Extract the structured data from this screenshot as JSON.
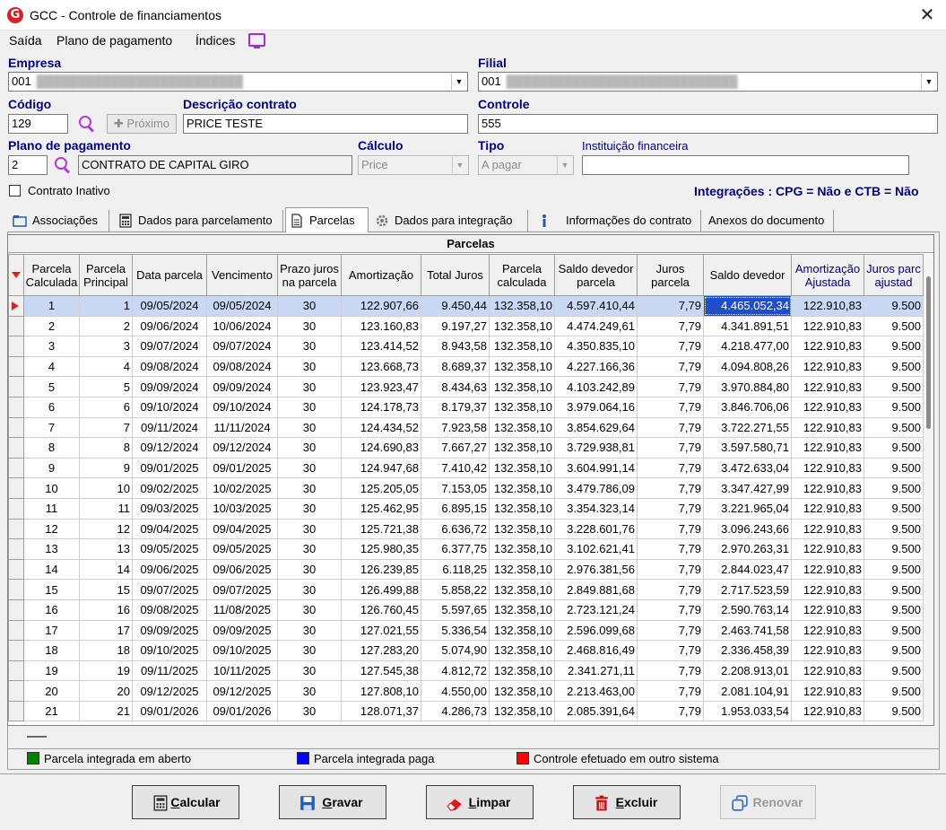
{
  "window": {
    "title": "GCC - Controle de financiamentos",
    "logo_letter": "G",
    "close_glyph": "✕"
  },
  "menu": [
    "Saída",
    "Plano de pagamento",
    "Índices"
  ],
  "form": {
    "empresa_label": "Empresa",
    "empresa_code": "001",
    "filial_label": "Filial",
    "filial_code": "001",
    "codigo_label": "Código",
    "codigo_value": "129",
    "proximo_label": "Próximo",
    "descricao_label": "Descrição contrato",
    "descricao_value": "PRICE TESTE",
    "controle_label": "Controle",
    "controle_value": "555",
    "plano_label": "Plano de pagamento",
    "plano_value": "2",
    "plano_desc": "CONTRATO DE CAPITAL GIRO",
    "calculo_label": "Cálculo",
    "calculo_value": "Price",
    "tipo_label": "Tipo",
    "tipo_value": "A pagar",
    "instituicao_label": "Instituição financeira",
    "instituicao_value": "",
    "inativo_label": "Contrato Inativo",
    "integracoes": "Integrações : CPG = Não e CTB = Não"
  },
  "tabs": [
    "Associações",
    "Dados para parcelamento",
    "Parcelas",
    "Dados para integração",
    "Informações do contrato",
    "Anexos do documento"
  ],
  "grid": {
    "caption": "Parcelas",
    "headers": [
      "Parcela Calculada",
      "Parcela Principal",
      "Data parcela",
      "Vencimento",
      "Prazo juros na parcela",
      "Amortização",
      "Total Juros",
      "Parcela calculada",
      "Saldo devedor parcela",
      "Juros parcela",
      "Saldo devedor",
      "Amortização Ajustada",
      "Juros parc ajustad"
    ],
    "rows": [
      [
        "1",
        "1",
        "09/05/2024",
        "09/05/2024",
        "30",
        "122.907,66",
        "9.450,44",
        "132.358,10",
        "4.597.410,44",
        "7,79",
        "4.465.052,34",
        "122.910,83",
        "9.500"
      ],
      [
        "2",
        "2",
        "09/06/2024",
        "10/06/2024",
        "30",
        "123.160,83",
        "9.197,27",
        "132.358,10",
        "4.474.249,61",
        "7,79",
        "4.341.891,51",
        "122.910,83",
        "9.500"
      ],
      [
        "3",
        "3",
        "09/07/2024",
        "09/07/2024",
        "30",
        "123.414,52",
        "8.943,58",
        "132.358,10",
        "4.350.835,10",
        "7,79",
        "4.218.477,00",
        "122.910,83",
        "9.500"
      ],
      [
        "4",
        "4",
        "09/08/2024",
        "09/08/2024",
        "30",
        "123.668,73",
        "8.689,37",
        "132.358,10",
        "4.227.166,36",
        "7,79",
        "4.094.808,26",
        "122.910,83",
        "9.500"
      ],
      [
        "5",
        "5",
        "09/09/2024",
        "09/09/2024",
        "30",
        "123.923,47",
        "8.434,63",
        "132.358,10",
        "4.103.242,89",
        "7,79",
        "3.970.884,80",
        "122.910,83",
        "9.500"
      ],
      [
        "6",
        "6",
        "09/10/2024",
        "09/10/2024",
        "30",
        "124.178,73",
        "8.179,37",
        "132.358,10",
        "3.979.064,16",
        "7,79",
        "3.846.706,06",
        "122.910,83",
        "9.500"
      ],
      [
        "7",
        "7",
        "09/11/2024",
        "11/11/2024",
        "30",
        "124.434,52",
        "7.923,58",
        "132.358,10",
        "3.854.629,64",
        "7,79",
        "3.722.271,55",
        "122.910,83",
        "9.500"
      ],
      [
        "8",
        "8",
        "09/12/2024",
        "09/12/2024",
        "30",
        "124.690,83",
        "7.667,27",
        "132.358,10",
        "3.729.938,81",
        "7,79",
        "3.597.580,71",
        "122.910,83",
        "9.500"
      ],
      [
        "9",
        "9",
        "09/01/2025",
        "09/01/2025",
        "30",
        "124.947,68",
        "7.410,42",
        "132.358,10",
        "3.604.991,14",
        "7,79",
        "3.472.633,04",
        "122.910,83",
        "9.500"
      ],
      [
        "10",
        "10",
        "09/02/2025",
        "10/02/2025",
        "30",
        "125.205,05",
        "7.153,05",
        "132.358,10",
        "3.479.786,09",
        "7,79",
        "3.347.427,99",
        "122.910,83",
        "9.500"
      ],
      [
        "11",
        "11",
        "09/03/2025",
        "10/03/2025",
        "30",
        "125.462,95",
        "6.895,15",
        "132.358,10",
        "3.354.323,14",
        "7,79",
        "3.221.965,04",
        "122.910,83",
        "9.500"
      ],
      [
        "12",
        "12",
        "09/04/2025",
        "09/04/2025",
        "30",
        "125.721,38",
        "6.636,72",
        "132.358,10",
        "3.228.601,76",
        "7,79",
        "3.096.243,66",
        "122.910,83",
        "9.500"
      ],
      [
        "13",
        "13",
        "09/05/2025",
        "09/05/2025",
        "30",
        "125.980,35",
        "6.377,75",
        "132.358,10",
        "3.102.621,41",
        "7,79",
        "2.970.263,31",
        "122.910,83",
        "9.500"
      ],
      [
        "14",
        "14",
        "09/06/2025",
        "09/06/2025",
        "30",
        "126.239,85",
        "6.118,25",
        "132.358,10",
        "2.976.381,56",
        "7,79",
        "2.844.023,47",
        "122.910,83",
        "9.500"
      ],
      [
        "15",
        "15",
        "09/07/2025",
        "09/07/2025",
        "30",
        "126.499,88",
        "5.858,22",
        "132.358,10",
        "2.849.881,68",
        "7,79",
        "2.717.523,59",
        "122.910,83",
        "9.500"
      ],
      [
        "16",
        "16",
        "09/08/2025",
        "11/08/2025",
        "30",
        "126.760,45",
        "5.597,65",
        "132.358,10",
        "2.723.121,24",
        "7,79",
        "2.590.763,14",
        "122.910,83",
        "9.500"
      ],
      [
        "17",
        "17",
        "09/09/2025",
        "09/09/2025",
        "30",
        "127.021,55",
        "5.336,54",
        "132.358,10",
        "2.596.099,68",
        "7,79",
        "2.463.741,58",
        "122.910,83",
        "9.500"
      ],
      [
        "18",
        "18",
        "09/10/2025",
        "09/10/2025",
        "30",
        "127.283,20",
        "5.074,90",
        "132.358,10",
        "2.468.816,49",
        "7,79",
        "2.336.458,39",
        "122.910,83",
        "9.500"
      ],
      [
        "19",
        "19",
        "09/11/2025",
        "10/11/2025",
        "30",
        "127.545,38",
        "4.812,72",
        "132.358,10",
        "2.341.271,11",
        "7,79",
        "2.208.913,01",
        "122.910,83",
        "9.500"
      ],
      [
        "20",
        "20",
        "09/12/2025",
        "09/12/2025",
        "30",
        "127.808,10",
        "4.550,00",
        "132.358,10",
        "2.213.463,00",
        "7,79",
        "2.081.104,91",
        "122.910,83",
        "9.500"
      ],
      [
        "21",
        "21",
        "09/01/2026",
        "09/01/2026",
        "30",
        "128.071,37",
        "4.286,73",
        "132.358,10",
        "2.085.391,64",
        "7,79",
        "1.953.033,54",
        "122.910,83",
        "9.500"
      ]
    ]
  },
  "legend": [
    {
      "label": "Parcela integrada em aberto",
      "color": "#008000"
    },
    {
      "label": "Parcela integrada paga",
      "color": "#0000ff"
    },
    {
      "label": "Controle efetuado em outro sistema",
      "color": "#ff0000"
    }
  ],
  "buttons": {
    "calcular": {
      "first": "C",
      "rest": "alcular"
    },
    "gravar": {
      "first": "G",
      "rest": "ravar"
    },
    "limpar": {
      "first": "L",
      "rest": "impar"
    },
    "excluir": {
      "first": "E",
      "rest": "xcluir"
    },
    "renovar": {
      "label": "Renovar"
    }
  },
  "colors": {
    "accent_label": "#000080",
    "selected_cell": "#1f4fc6",
    "selected_row": "#c8d8f5",
    "icon_purple": "#b23bd6"
  }
}
